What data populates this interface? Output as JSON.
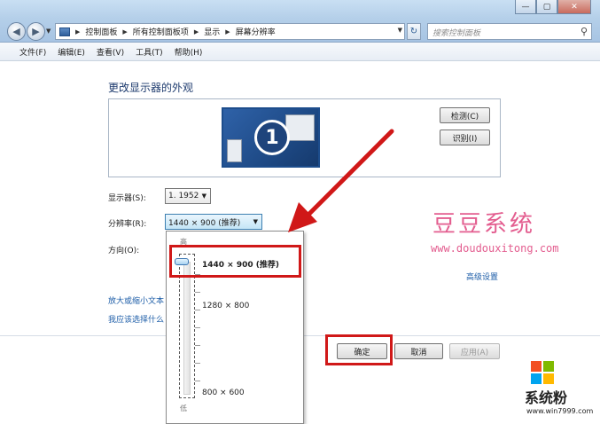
{
  "window": {
    "minimize_icon": "minimize-icon",
    "maximize_icon": "maximize-icon",
    "close_icon": "close-icon"
  },
  "address": {
    "breadcrumbs": [
      "控制面板",
      "所有控制面板项",
      "显示",
      "屏幕分辨率"
    ],
    "search_placeholder": "搜索控制面板"
  },
  "menu": [
    "文件(F)",
    "编辑(E)",
    "查看(V)",
    "工具(T)",
    "帮助(H)"
  ],
  "main": {
    "heading": "更改显示器的外观",
    "monitor_number": "1",
    "detect_button": "检测(C)",
    "identify_button": "识别(I)",
    "display_label": "显示器(S):",
    "display_value": "1. 1952",
    "resolution_label": "分辨率(R):",
    "resolution_value": "1440 × 900 (推荐)",
    "orientation_label": "方向(O):",
    "advanced_link": "高级设置",
    "link_text_size": "放大或缩小文本",
    "link_choose": "我应该选择什么"
  },
  "dropdown": {
    "high_label": "高",
    "low_label": "低",
    "options": [
      "1440 × 900 (推荐)",
      "1280 × 800",
      "800 × 600"
    ],
    "selected_index": 0
  },
  "footer": {
    "ok_button": "确定",
    "cancel_button": "取消",
    "apply_button": "应用(A)"
  },
  "watermark": {
    "title": "豆豆系统",
    "url": "www.doudouxitong.com"
  },
  "logo": {
    "text": "系统粉",
    "url": "www.win7999.com",
    "colors": [
      "#f25022",
      "#7fba00",
      "#00a4ef",
      "#ffb900"
    ]
  },
  "annotation_color": "#d01818"
}
